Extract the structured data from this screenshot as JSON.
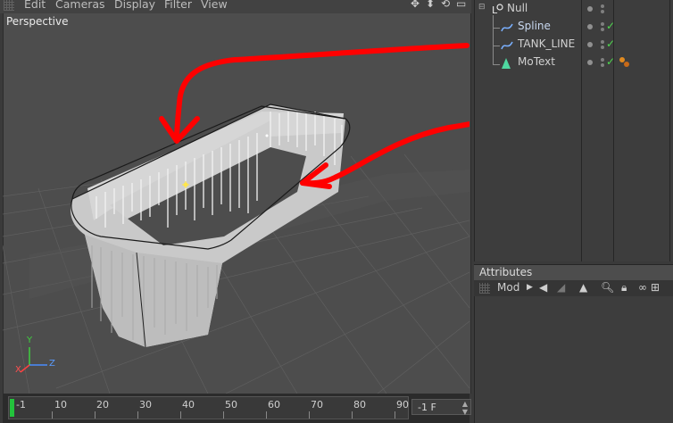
{
  "menu": {
    "items": [
      "Edit",
      "Cameras",
      "Display",
      "Filter",
      "View"
    ]
  },
  "viewport": {
    "label": "Perspective",
    "axes": {
      "y": "Y",
      "x": "X",
      "z": "Z"
    }
  },
  "timeline": {
    "ticks": [
      "-1",
      "10",
      "20",
      "30",
      "40",
      "50",
      "60",
      "70",
      "80",
      "90"
    ],
    "current_frame": "-1 F"
  },
  "object_manager": {
    "objects": [
      {
        "name": "Null",
        "icon": "null-icon",
        "enabled": false
      },
      {
        "name": "Spline",
        "icon": "spline-icon",
        "enabled": true
      },
      {
        "name": "TANK_LINE",
        "icon": "spline-icon",
        "enabled": true
      },
      {
        "name": "MoText",
        "icon": "motext-icon",
        "enabled": true,
        "tag": "material-tag"
      }
    ]
  },
  "attributes": {
    "title": "Attributes",
    "mode_label": "Mod"
  },
  "colors": {
    "annotation_red": "#ff0000",
    "check_green": "#4fd84f",
    "playhead_green": "#23c33c"
  }
}
